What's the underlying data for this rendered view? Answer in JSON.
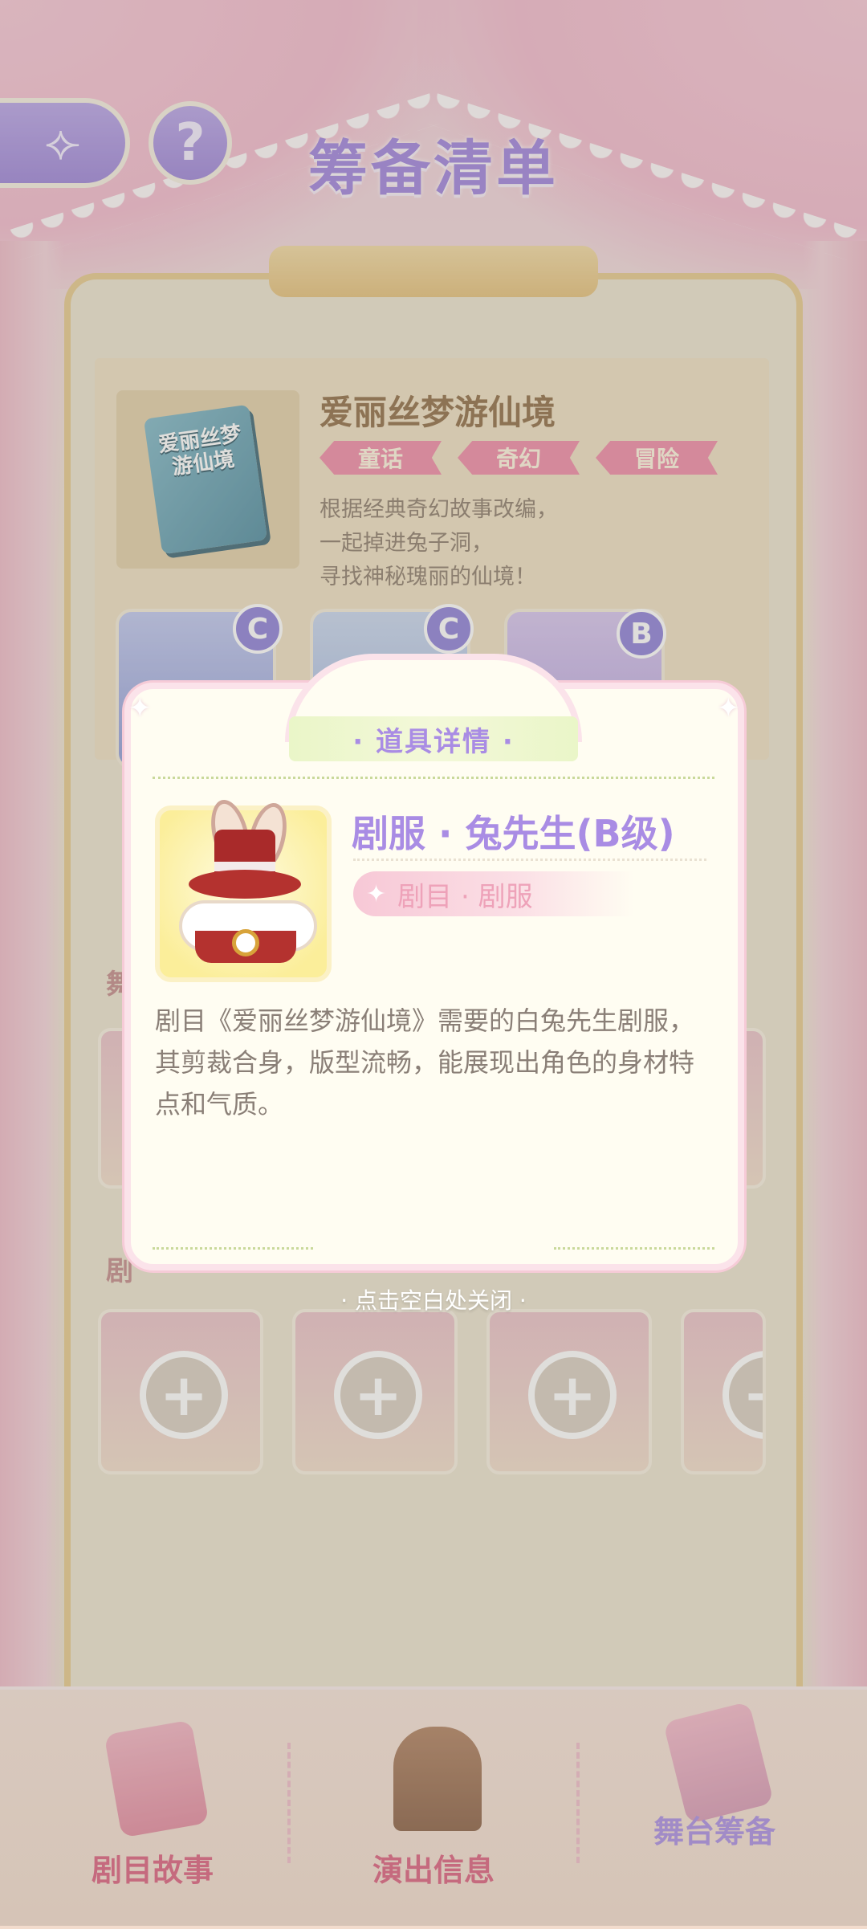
{
  "header": {
    "back_label": "⟣",
    "help_label": "?",
    "title": "筹备清单"
  },
  "drama": {
    "cover_title": "爱丽丝梦游仙境",
    "name": "爱丽丝梦游仙境",
    "tags": [
      "童话",
      "奇幻",
      "冒险"
    ],
    "description_lines": [
      "根据经典奇幻故事改编，",
      "一起掉进兔子洞，",
      "寻找神秘瑰丽的仙境！"
    ],
    "roles": [
      {
        "grade": "C"
      },
      {
        "grade": "C"
      },
      {
        "grade": "B"
      }
    ]
  },
  "sections": {
    "costume_label": "舞",
    "props_label": "剧"
  },
  "popup": {
    "header": "· 道具详情 ·",
    "item_name": "剧服 · 兔先生(B级)",
    "item_type": "剧目 · 剧服",
    "description": "剧目《爱丽丝梦游仙境》需要的白兔先生剧服，其剪裁合身，版型流畅，能展现出角色的身材特点和气质。",
    "close_hint": "· 点击空白处关闭 ·"
  },
  "slots": {
    "plus": "+"
  },
  "bottom_nav": [
    {
      "label": "剧目故事",
      "active": false
    },
    {
      "label": "演出信息",
      "active": false
    },
    {
      "label": "舞台筹备",
      "active": true
    }
  ],
  "colors": {
    "accent_purple": "#a98ce4",
    "accent_pink": "#dc5f7f",
    "tag_pink": "#f08aa7",
    "gold": "#e7c98c"
  }
}
